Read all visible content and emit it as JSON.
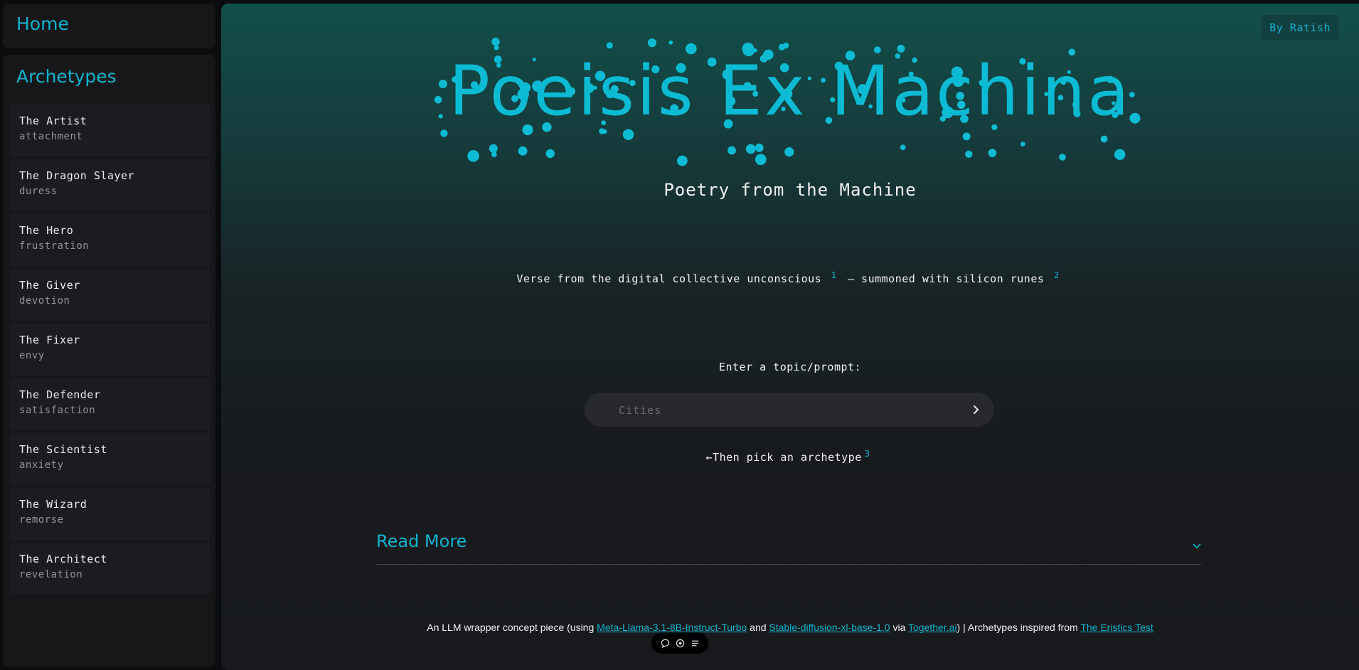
{
  "sidebar": {
    "home_label": "Home",
    "archetypes_title": "Archetypes",
    "archetypes": [
      {
        "name": "The Artist",
        "emotion": "attachment"
      },
      {
        "name": "The Dragon Slayer",
        "emotion": "duress"
      },
      {
        "name": "The Hero",
        "emotion": "frustration"
      },
      {
        "name": "The Giver",
        "emotion": "devotion"
      },
      {
        "name": "The Fixer",
        "emotion": "envy"
      },
      {
        "name": "The Defender",
        "emotion": "satisfaction"
      },
      {
        "name": "The Scientist",
        "emotion": "anxiety"
      },
      {
        "name": "The Wizard",
        "emotion": "remorse"
      },
      {
        "name": "The Architect",
        "emotion": "revelation"
      }
    ]
  },
  "header": {
    "by_label": "By Ratish"
  },
  "hero": {
    "title": "Poeisis Ex Machina",
    "subtitle": "Poetry from the Machine",
    "verse_part1": "Verse from the digital collective unconscious",
    "verse_sup1": "1",
    "verse_part2": "— summoned with silicon runes",
    "verse_sup2": "2"
  },
  "prompt": {
    "label": "Enter a topic/prompt:",
    "placeholder": "Cities",
    "pick_text": "←Then pick an archetype",
    "pick_sup": "3"
  },
  "readmore": {
    "label": "Read More"
  },
  "footer": {
    "prefix": "An LLM wrapper concept piece (using ",
    "link1": "Meta-Llama-3.1-8B-Instruct-Turbo",
    "and": " and ",
    "link2": "Stable-diffusion-xl-base-1.0",
    "via": " via ",
    "link3": "Together.ai",
    "mid": ") | Archetypes inspired from ",
    "link4": "The Eristics Test"
  },
  "colors": {
    "accent": "#0fb3cf",
    "title": "#0bbbd3",
    "panel": "#161719"
  }
}
